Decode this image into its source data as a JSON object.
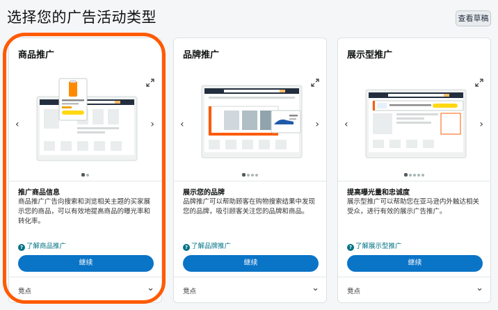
{
  "page": {
    "title": "选择您的广告活动类型",
    "drafts_button": "查看草稿"
  },
  "colors": {
    "accent": "#0a74c7",
    "highlight": "#ff5a00",
    "link": "#007185"
  },
  "cards": [
    {
      "title": "商品推广",
      "subtitle": "推广商品信息",
      "description": "商品推广广告向搜索和浏览相关主题的买家展示您的商品，可以有效地提高商品的曝光率和转化率。",
      "learn_more": "了解商品推广",
      "continue_label": "继续",
      "footer_label": "竞点",
      "pages": 2,
      "active_page": 1
    },
    {
      "title": "品牌推广",
      "subtitle": "展示您的品牌",
      "description": "品牌推广可以帮助顾客在购物搜索结果中发现您的品牌，吸引顾客关注您的品牌和商品。",
      "learn_more": "了解品牌推广",
      "continue_label": "继续",
      "footer_label": "竞点",
      "pages": 4,
      "active_page": 1
    },
    {
      "title": "展示型推广",
      "subtitle": "提高曝光量和忠诚度",
      "description": "展示型推广可以帮助您在亚马逊内外触达相关受众，进行有效的展示广告推广。",
      "learn_more": "了解展示型推广",
      "continue_label": "继续",
      "footer_label": "竞点",
      "pages": 5,
      "active_page": 1
    }
  ]
}
